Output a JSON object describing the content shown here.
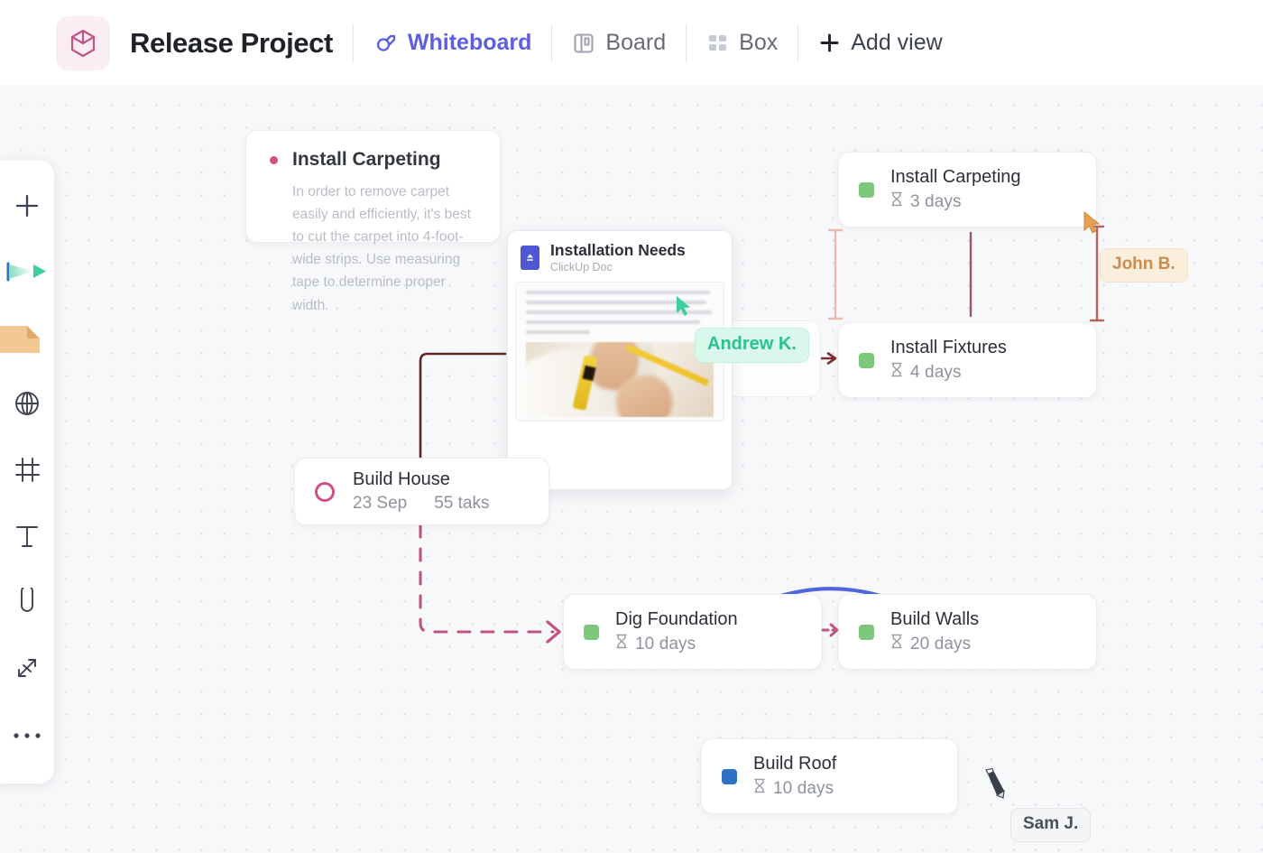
{
  "header": {
    "logo_icon": "cube-icon",
    "title": "Release Project",
    "views": [
      {
        "label": "Whiteboard",
        "icon": "whiteboard-icon",
        "active": true
      },
      {
        "label": "Board",
        "icon": "board-icon",
        "active": false
      },
      {
        "label": "Box",
        "icon": "box-grid-icon",
        "active": false
      },
      {
        "label": "Add view",
        "icon": "plus-icon",
        "active": false
      }
    ]
  },
  "toolbar": {
    "items": [
      {
        "name": "add-tool",
        "icon": "plus-icon"
      },
      {
        "name": "select-tool",
        "icon": "cursor-flag-icon"
      },
      {
        "name": "sticky-note-tool",
        "icon": "sticky-note-icon"
      },
      {
        "name": "shape-tool",
        "icon": "globe-icon"
      },
      {
        "name": "frame-tool",
        "icon": "frame-grid-icon"
      },
      {
        "name": "text-tool",
        "icon": "text-t-icon"
      },
      {
        "name": "attachment-tool",
        "icon": "paperclip-icon"
      },
      {
        "name": "connector-tool",
        "icon": "connector-arrows-icon"
      },
      {
        "name": "more-tools",
        "icon": "ellipsis-icon"
      }
    ]
  },
  "canvas": {
    "sticky_note": {
      "title": "Install Carpeting",
      "body": "In order to remove carpet easily and efficiently, it's best to cut the carpet into 4-foot-wide strips. Use measuring tape to determine proper width.",
      "dot_color": "#cf4f86"
    },
    "doc_card": {
      "title": "Installation Needs",
      "subtitle": "ClickUp Doc",
      "icon": "clickup-doc-icon",
      "photo_alt": "hands cutting carpet with a yellow utility knife and ruler"
    },
    "tasks": [
      {
        "name": "install-carpeting",
        "title": "Install Carpeting",
        "duration": "3 days",
        "duration_icon": "hourglass-icon",
        "status_color": "#7ec87e",
        "status_shape": "square"
      },
      {
        "name": "install-fixtures",
        "title": "Install Fixtures",
        "duration": "4 days",
        "duration_icon": "hourglass-icon",
        "status_color": "#7ec87e",
        "status_shape": "square"
      },
      {
        "name": "build-house",
        "title": "Build House",
        "date": "23 Sep",
        "tasks_count": "55 taks",
        "status_color": "#cf4f86",
        "status_shape": "ring"
      },
      {
        "name": "dig-foundation",
        "title": "Dig Foundation",
        "duration": "10 days",
        "duration_icon": "hourglass-icon",
        "status_color": "#7ec87e",
        "status_shape": "square"
      },
      {
        "name": "build-walls",
        "title": "Build Walls",
        "duration": "20 days",
        "duration_icon": "hourglass-icon",
        "status_color": "#7ec87e",
        "status_shape": "square"
      },
      {
        "name": "build-roof",
        "title": "Build Roof",
        "duration": "10 days",
        "duration_icon": "hourglass-icon",
        "status_color": "#2f6fc4",
        "status_shape": "square"
      }
    ],
    "collaborators": [
      {
        "name": "Andrew K.",
        "label": "Andrew K.",
        "color": "#2bc28d",
        "cursor": "arrow"
      },
      {
        "name": "John B.",
        "label": "John B.",
        "color": "#c98e4e",
        "cursor": "arrow"
      },
      {
        "name": "Sam J.",
        "label": "Sam J.",
        "color": "#4b4f59",
        "cursor": "pen"
      }
    ],
    "connectors": [
      {
        "name": "doc-to-build-house",
        "style": "solid",
        "color": "#5e2626"
      },
      {
        "name": "build-house-to-dig-foundation",
        "style": "dashed",
        "color": "#c0557f"
      },
      {
        "name": "dig-foundation-to-build-walls",
        "style": "dashed",
        "color": "#c0557f"
      },
      {
        "name": "doc-to-install-fixtures",
        "style": "solid",
        "color": "#7a2e2e"
      },
      {
        "name": "dig-foundation-to-build-walls-curve",
        "style": "curved-double",
        "color": "#5065db"
      }
    ]
  },
  "colors": {
    "accent": "#5b5fe0",
    "brand_pink": "#cf4f86",
    "status_green": "#7ec87e",
    "status_blue": "#2f6fc4",
    "canvas_bg": "#f7f8fa"
  }
}
